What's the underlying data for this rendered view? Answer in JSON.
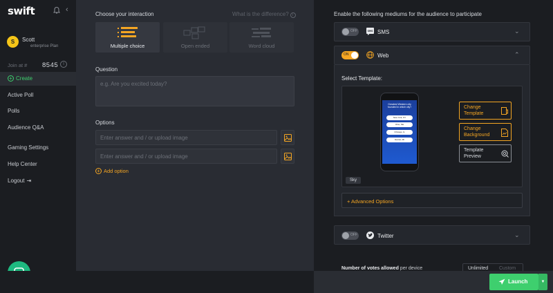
{
  "app": {
    "logo": "swift"
  },
  "sidebar": {
    "user": {
      "initial": "S",
      "name": "Scott",
      "plan": "enterprise Plan"
    },
    "join": {
      "label": "Join at #",
      "code": "8545"
    },
    "create_label": "Create",
    "items": [
      {
        "label": "Active Poll"
      },
      {
        "label": "Polls"
      },
      {
        "label": "Audience Q&A"
      },
      {
        "label": "Gaming Settings"
      },
      {
        "label": "Help Center"
      },
      {
        "label": "Logout"
      }
    ]
  },
  "interaction": {
    "title": "Choose your interaction",
    "difference_link": "What is the difference?",
    "types": [
      {
        "label": "Multiple choice",
        "active": true
      },
      {
        "label": "Open ended",
        "active": false
      },
      {
        "label": "Word cloud",
        "active": false
      }
    ]
  },
  "question": {
    "label": "Question",
    "placeholder": "e.g. Are you excited today?"
  },
  "options": {
    "label": "Options",
    "inputs": [
      {
        "placeholder": "Enter answer and / or upload image"
      },
      {
        "placeholder": "Enter answer and / or upload image"
      }
    ],
    "add_label": "Add option"
  },
  "mediums": {
    "title": "Enable the following mediums for the audience to participate",
    "sms": {
      "label": "SMS",
      "toggle": "OFF",
      "enabled": false
    },
    "web": {
      "label": "Web",
      "toggle": "ON",
      "enabled": true,
      "select_template_label": "Select Template:",
      "template_name": "Sky",
      "phone": {
        "question": "Greatest Western city founded in which city?",
        "options": [
          "New York, NY",
          "Ohio, NE",
          "Chicago, IL",
          "Detroit, MI"
        ]
      },
      "buttons": {
        "change_template": "Change Template",
        "change_background": "Change Background",
        "template_preview": "Template Preview"
      },
      "advanced_options": "+ Advanced Options"
    },
    "twitter": {
      "label": "Twitter",
      "toggle": "OFF",
      "enabled": false
    }
  },
  "votes": {
    "label_bold": "Number of votes allowed",
    "label_rest": " per device",
    "options": [
      "Unlimited",
      "Custom"
    ]
  },
  "launch": {
    "label": "Launch"
  },
  "colors": {
    "accent": "#f5a623",
    "success": "#3ecf6e",
    "bg": "#1b1d21",
    "panel": "#292c33"
  }
}
